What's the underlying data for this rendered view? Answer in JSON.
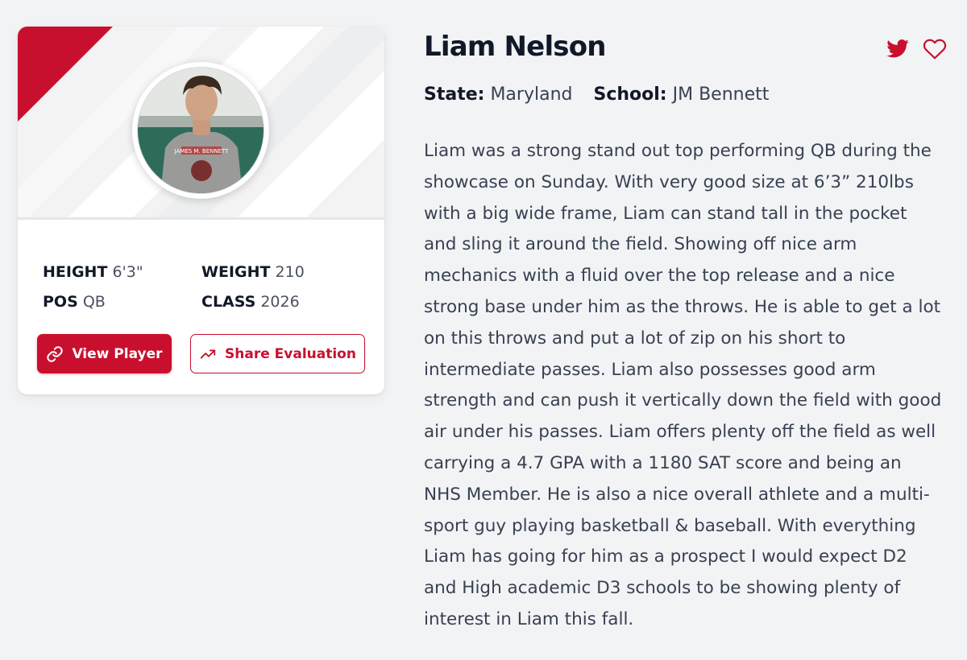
{
  "player": {
    "name": "Liam Nelson",
    "photo_label": "JAMES M. BENNETT"
  },
  "card": {
    "stats": [
      {
        "key": "HEIGHT",
        "value": "6'3\""
      },
      {
        "key": "WEIGHT",
        "value": "210"
      },
      {
        "key": "POS",
        "value": "QB"
      },
      {
        "key": "CLASS",
        "value": "2026"
      }
    ],
    "buttons": {
      "view_player": "View Player",
      "share_evaluation": "Share Evaluation"
    },
    "icons": {
      "view_player": "link-icon",
      "share_evaluation": "trending-up-icon"
    }
  },
  "details": {
    "state_label": "State:",
    "state_value": "Maryland",
    "school_label": "School:",
    "school_value": "JM Bennett"
  },
  "actions": {
    "icons": [
      "twitter-icon",
      "heart-icon"
    ]
  },
  "evaluation": "Liam was a strong stand out top performing QB during the showcase on Sunday. With very good size at 6’3” 210lbs with a big wide frame, Liam can stand tall in the pocket and sling it around the field. Showing off nice arm mechanics with a fluid over the top release and a nice strong base under him as the throws. He is able to get a lot on this throws and put a lot of zip on his short to intermediate passes. Liam also possesses good arm strength and can push it vertically down the field with good air under his passes. Liam offers plenty off the field as well carrying a 4.7 GPA with a 1180 SAT score and being an NHS Member. He is also a nice overall athlete and a multi-sport guy playing basketball & baseball. With everything Liam has going for him as a prospect I would expect D2 and High academic D3 schools to be showing plenty of interest in Liam this fall.",
  "colors": {
    "accent": "#c8102e",
    "background": "#f2f3f5",
    "card": "#ffffff",
    "text_dark": "#111827",
    "text_body": "#374151"
  }
}
